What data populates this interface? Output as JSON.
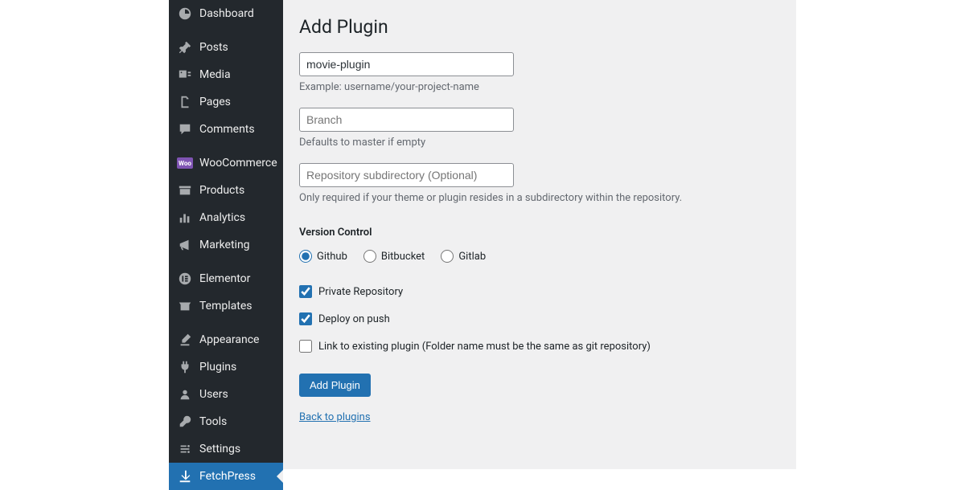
{
  "sidebar": {
    "items": [
      {
        "label": "Dashboard",
        "icon": "dashboard"
      },
      {
        "label": "Posts",
        "icon": "pin"
      },
      {
        "label": "Media",
        "icon": "media"
      },
      {
        "label": "Pages",
        "icon": "pages"
      },
      {
        "label": "Comments",
        "icon": "comments"
      },
      {
        "label": "WooCommerce",
        "icon": "woo"
      },
      {
        "label": "Products",
        "icon": "products"
      },
      {
        "label": "Analytics",
        "icon": "analytics"
      },
      {
        "label": "Marketing",
        "icon": "marketing"
      },
      {
        "label": "Elementor",
        "icon": "elementor"
      },
      {
        "label": "Templates",
        "icon": "templates"
      },
      {
        "label": "Appearance",
        "icon": "appearance"
      },
      {
        "label": "Plugins",
        "icon": "plugins"
      },
      {
        "label": "Users",
        "icon": "users"
      },
      {
        "label": "Tools",
        "icon": "tools"
      },
      {
        "label": "Settings",
        "icon": "settings"
      },
      {
        "label": "FetchPress",
        "icon": "fetchpress"
      }
    ]
  },
  "page": {
    "title": "Add Plugin",
    "repo_value": "movie-plugin",
    "repo_help": "Example: username/your-project-name",
    "branch_placeholder": "Branch",
    "branch_help": "Defaults to master if empty",
    "subdir_placeholder": "Repository subdirectory (Optional)",
    "subdir_help": "Only required if your theme or plugin resides in a subdirectory within the repository.",
    "vc_label": "Version Control",
    "vc_options": {
      "github": "Github",
      "bitbucket": "Bitbucket",
      "gitlab": "Gitlab"
    },
    "chk_private": "Private Repository",
    "chk_deploy": "Deploy on push",
    "chk_link": "Link to existing plugin (Folder name must be the same as git repository)",
    "submit": "Add Plugin",
    "back_link": "Back to plugins"
  }
}
